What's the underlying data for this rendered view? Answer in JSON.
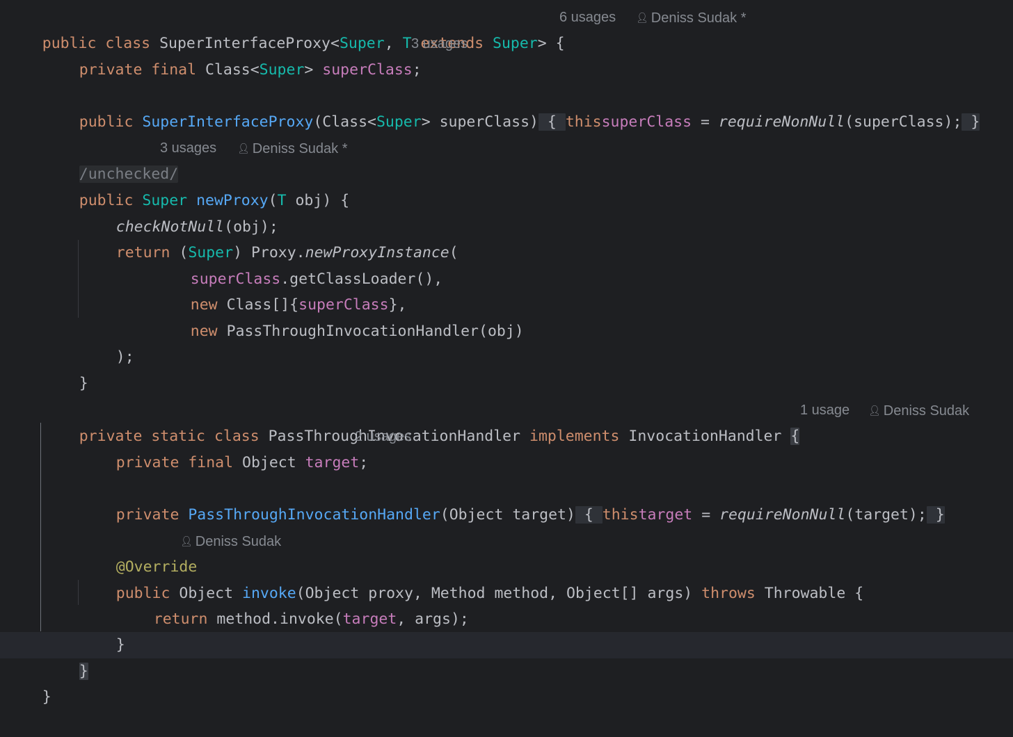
{
  "theme": {
    "background": "#1e1f22",
    "keyword": "#cf8e6d",
    "type_param": "#16baac",
    "field": "#c77dbb",
    "declaration": "#56a8f5",
    "annotation": "#b3ae60",
    "default_text": "#bcbec4",
    "inlay_hint": "#868a91"
  },
  "code": {
    "l1": {
      "a": "public class ",
      "b": "SuperInterfaceProxy<",
      "c": "Super",
      ",": ", ",
      "d": "T",
      "e": " extends ",
      "f": "Super",
      "g": "> {"
    },
    "l2": {
      "a": "private final ",
      "b": "Class<",
      "c": "Super",
      "d": "> ",
      "e": "superClass",
      "f": ";"
    },
    "l3": {
      "a": "public ",
      "b": "SuperInterfaceProxy",
      "c": "(Class<",
      "d": "Super",
      "e": "> superClass)",
      "f": " { ",
      "g": "this",
      ".": ".",
      "h": "superClass",
      "i": " = ",
      "j": "requireNonNull",
      "k": "(superClass);",
      "l": " }"
    },
    "l4": {
      "a": "/unchecked/"
    },
    "l5": {
      "a": "public ",
      "b": "Super",
      "c": " ",
      "d": "newProxy",
      "e": "(",
      "f": "T",
      "g": " obj) {"
    },
    "l6": {
      "a": "checkNotNull",
      "b": "(obj);"
    },
    "l7": {
      "a": "return ",
      "b": "(",
      "c": "Super",
      "d": ") Proxy.",
      "e": "newProxyInstance",
      "f": "("
    },
    "l8": {
      "a": "superClass",
      "b": ".getClassLoader(),"
    },
    "l9": {
      "a": "new ",
      "b": "Class[]{",
      "c": "superClass",
      "d": "},"
    },
    "l10": {
      "a": "new ",
      "b": "PassThroughInvocationHandler(obj)"
    },
    "l11": {
      "a": ");"
    },
    "l12": {
      "a": "}"
    },
    "l13": {
      "a": "private static class ",
      "b": "PassThroughInvocationHandler ",
      "c": "implements ",
      "d": "InvocationHandler ",
      "e": "{"
    },
    "l14": {
      "a": "private final ",
      "b": "Object ",
      "c": "target",
      "d": ";"
    },
    "l15": {
      "a": "private ",
      "b": "PassThroughInvocationHandler",
      "c": "(Object target)",
      "f": " { ",
      "g": "this",
      ".": ".",
      "h": "target",
      "i": " = ",
      "j": "requireNonNull",
      "k": "(target);",
      "l": " }"
    },
    "l16": {
      "a": "@Override"
    },
    "l17": {
      "a": "public ",
      "b": "Object ",
      "c": "invoke",
      "d": "(Object proxy, Method method, Object[] args) ",
      "e": "throws ",
      "f": "Throwable {"
    },
    "l18": {
      "a": "return ",
      "b": "method.invoke(",
      "c": "target",
      "d": ", args);"
    },
    "l19": {
      "a": "}"
    },
    "l20": {
      "a": "}"
    },
    "l21": {
      "a": "}"
    }
  },
  "hints": {
    "h1_usages": "6 usages",
    "h1_author": "Deniss Sudak *",
    "h2_usages": "3 usages",
    "h4_usages": "3 usages",
    "h4_author": "Deniss Sudak *",
    "h13_usages": "1 usage",
    "h13_author": "Deniss Sudak",
    "h14_usages": "2 usages",
    "h16_author": "Deniss Sudak",
    "person_icon": "person-icon"
  }
}
